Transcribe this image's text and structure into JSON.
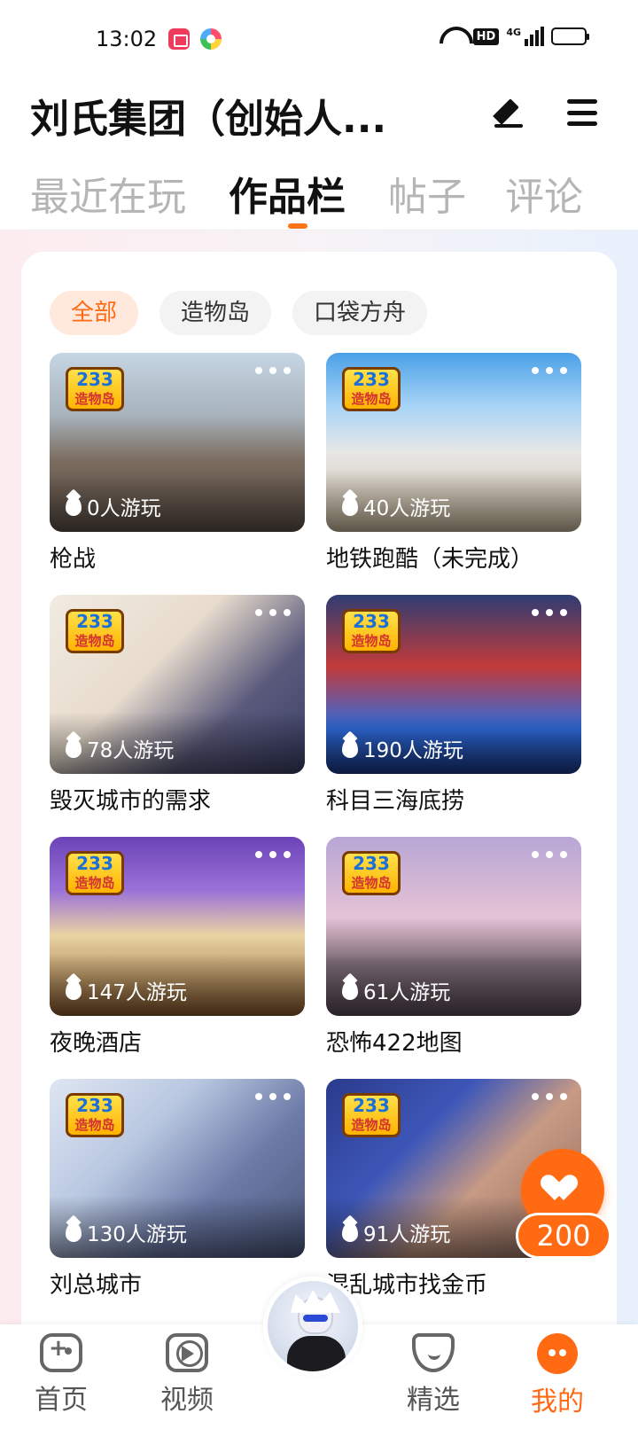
{
  "status_bar": {
    "time": "13:02",
    "hd_label": "HD",
    "signal_label": "4G",
    "battery_level": 0.45
  },
  "header": {
    "title": "刘氏集团（创始人...",
    "edit_icon": "pencil-icon",
    "menu_icon": "hamburger-menu-icon"
  },
  "tabs": [
    {
      "label": "最近在玩",
      "active": false
    },
    {
      "label": "作品栏",
      "active": true
    },
    {
      "label": "帖子",
      "active": false
    },
    {
      "label": "评论",
      "active": false
    }
  ],
  "filters": [
    {
      "label": "全部",
      "active": true
    },
    {
      "label": "造物岛",
      "active": false
    },
    {
      "label": "口袋方舟",
      "active": false
    }
  ],
  "works": [
    {
      "title": "枪战",
      "players": "0人游玩",
      "badge_top": "233",
      "badge_bottom": "造物岛"
    },
    {
      "title": "地铁跑酷（未完成）",
      "players": "40人游玩",
      "badge_top": "233",
      "badge_bottom": "造物岛"
    },
    {
      "title": "毁灭城市的需求",
      "players": "78人游玩",
      "badge_top": "233",
      "badge_bottom": "造物岛"
    },
    {
      "title": "科目三海底捞",
      "players": "190人游玩",
      "badge_top": "233",
      "badge_bottom": "造物岛"
    },
    {
      "title": "夜晚酒店",
      "players": "147人游玩",
      "badge_top": "233",
      "badge_bottom": "造物岛"
    },
    {
      "title": "恐怖422地图",
      "players": "61人游玩",
      "badge_top": "233",
      "badge_bottom": "造物岛"
    },
    {
      "title": "刘总城市",
      "players": "130人游玩",
      "badge_top": "233",
      "badge_bottom": "造物岛"
    },
    {
      "title": "混乱城市找金币",
      "players": "91人游玩",
      "badge_top": "233",
      "badge_bottom": "造物岛"
    }
  ],
  "like": {
    "count": "200"
  },
  "bottom_nav": [
    {
      "label": "首页",
      "icon": "gamepad-icon",
      "active": false
    },
    {
      "label": "视频",
      "icon": "video-play-icon",
      "active": false
    },
    {
      "label": "精选",
      "icon": "gem-heart-icon",
      "active": false
    },
    {
      "label": "我的",
      "icon": "smile-face-icon",
      "active": true
    }
  ],
  "colors": {
    "accent": "#ff6a13",
    "chip_active_bg": "#ffe9dd",
    "text_primary": "#111111",
    "tab_inactive": "#b5b5b5"
  }
}
